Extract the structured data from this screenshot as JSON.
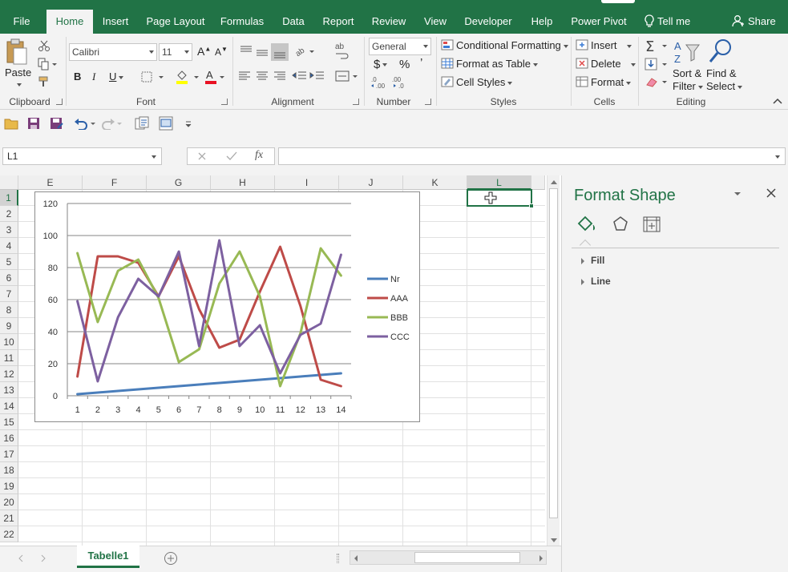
{
  "tabs": [
    "File",
    "Home",
    "Insert",
    "Page Layout",
    "Formulas",
    "Data",
    "Report",
    "Review",
    "View",
    "Developer",
    "Help",
    "Power Pivot"
  ],
  "active_tab": "Home",
  "tell_me": "Tell me",
  "share": "Share",
  "ribbon": {
    "clipboard": {
      "label": "Clipboard",
      "paste": "Paste"
    },
    "font": {
      "label": "Font",
      "name": "Calibri",
      "size": "11",
      "bold": "B",
      "italic": "I",
      "underline": "U",
      "grow": "A",
      "shrink": "A"
    },
    "alignment": {
      "label": "Alignment"
    },
    "number": {
      "label": "Number",
      "format": "General",
      "dollar": "$",
      "percent": "%",
      "comma": "’"
    },
    "styles": {
      "label": "Styles",
      "conditional": "Conditional Formatting",
      "table": "Format as Table",
      "cell_styles": "Cell Styles"
    },
    "cells": {
      "label": "Cells",
      "insert": "Insert",
      "delete": "Delete",
      "format": "Format"
    },
    "editing": {
      "label": "Editing",
      "sort1": "Sort &",
      "sort2": "Filter",
      "find1": "Find &",
      "find2": "Select"
    }
  },
  "namebox": "L1",
  "columns": [
    "E",
    "F",
    "G",
    "H",
    "I",
    "J",
    "K",
    "L"
  ],
  "rows": [
    "1",
    "2",
    "3",
    "4",
    "5",
    "6",
    "7",
    "8",
    "9",
    "10",
    "11",
    "12",
    "13",
    "14",
    "15",
    "16",
    "17",
    "18",
    "19",
    "20",
    "21",
    "22"
  ],
  "sheet_tab": "Tabelle1",
  "pane": {
    "title": "Format Shape",
    "fill": "Fill",
    "line": "Line"
  },
  "colors": {
    "accent": "#217346"
  },
  "chart_data": {
    "type": "line",
    "categories": [
      1,
      2,
      3,
      4,
      5,
      6,
      7,
      8,
      9,
      10,
      11,
      12,
      13,
      14
    ],
    "ylim": [
      0,
      120
    ],
    "yticks": [
      0,
      20,
      40,
      60,
      80,
      100,
      120
    ],
    "grid": true,
    "legend": "right",
    "series": [
      {
        "name": "Nr",
        "color": "#4a7ebb",
        "values": [
          1,
          2,
          3,
          4,
          5,
          6,
          7,
          8,
          9,
          10,
          11,
          12,
          13,
          14
        ]
      },
      {
        "name": "AAA",
        "color": "#be4b48",
        "values": [
          12,
          87,
          87,
          83,
          62,
          87,
          54,
          30,
          35,
          65,
          93,
          56,
          10,
          6
        ]
      },
      {
        "name": "BBB",
        "color": "#98b954",
        "values": [
          89,
          46,
          78,
          85,
          61,
          21,
          29,
          70,
          90,
          62,
          6,
          39,
          92,
          75
        ]
      },
      {
        "name": "CCC",
        "color": "#7d60a0",
        "values": [
          59,
          9,
          49,
          73,
          62,
          90,
          31,
          97,
          31,
          44,
          14,
          38,
          45,
          88
        ]
      }
    ]
  }
}
